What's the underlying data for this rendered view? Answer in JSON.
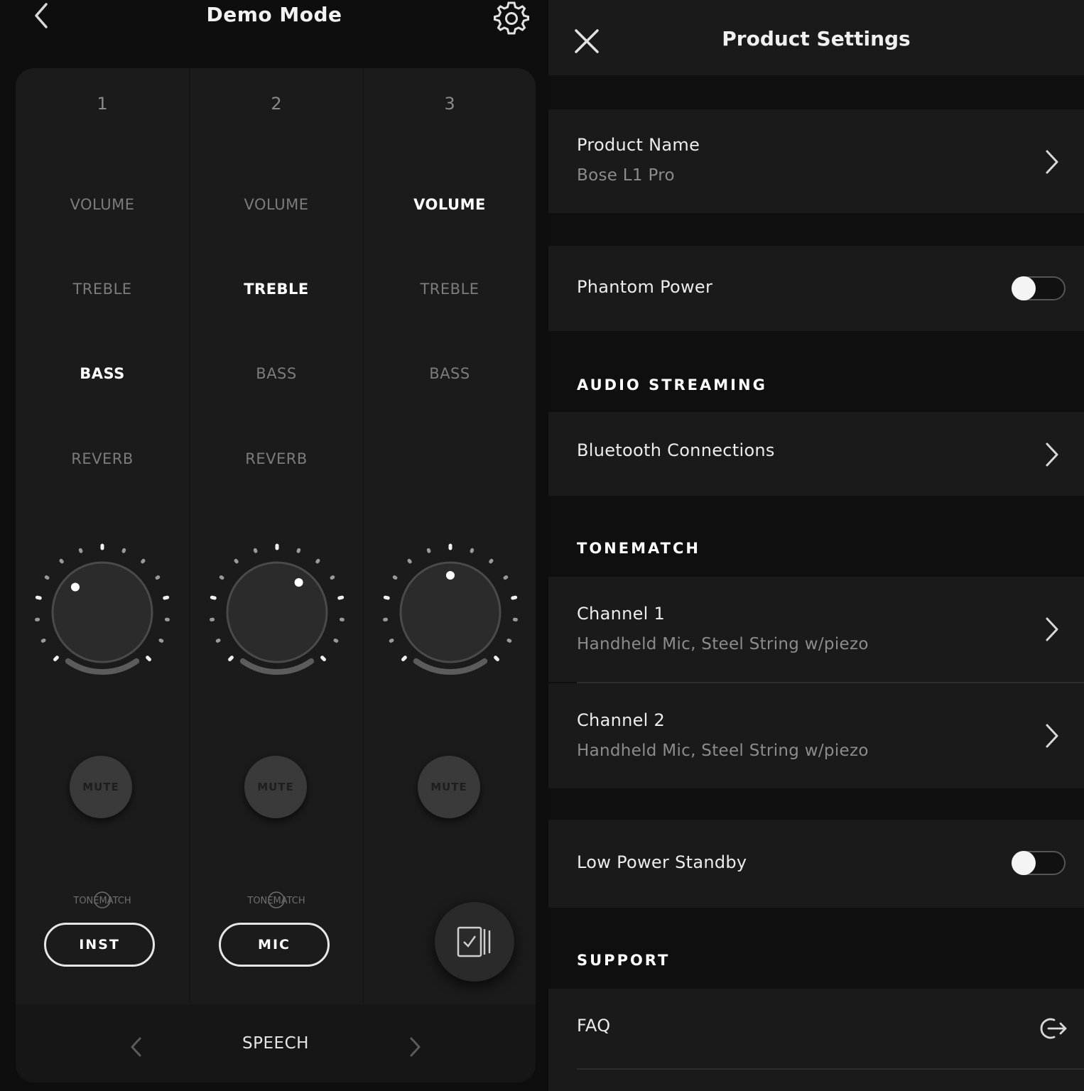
{
  "demo": {
    "title": "Demo Mode",
    "channels": [
      {
        "number": "1",
        "params": [
          "VOLUME",
          "TREBLE",
          "BASS",
          "REVERB"
        ],
        "active": "BASS",
        "mute_label": "MUTE",
        "tonematch_label": "INST"
      },
      {
        "number": "2",
        "params": [
          "VOLUME",
          "TREBLE",
          "BASS",
          "REVERB"
        ],
        "active": "TREBLE",
        "mute_label": "MUTE",
        "tonematch_label": "MIC"
      },
      {
        "number": "3",
        "params": [
          "VOLUME",
          "TREBLE",
          "BASS"
        ],
        "active": "VOLUME",
        "mute_label": "MUTE"
      }
    ],
    "tonematch_logo": "TONEMATCH",
    "scene": "SPEECH"
  },
  "settings": {
    "title": "Product Settings",
    "product_name_label": "Product Name",
    "product_name_value": "Bose L1 Pro",
    "phantom_power_label": "Phantom Power",
    "audio_streaming_header": "AUDIO STREAMING",
    "bluetooth_label": "Bluetooth Connections",
    "tonematch_header": "TONEMATCH",
    "channel1_label": "Channel 1",
    "channel1_value": "Handheld Mic, Steel String w/piezo",
    "channel2_label": "Channel 2",
    "channel2_value": "Handheld Mic, Steel String w/piezo",
    "low_power_label": "Low Power Standby",
    "support_header": "SUPPORT",
    "faq_label": "FAQ"
  },
  "icons": {
    "back": "chevron-left-icon",
    "settings": "gear-icon",
    "close": "close-icon",
    "chevron": "chevron-right-icon",
    "external": "external-link-icon",
    "presets": "preset-library-icon"
  },
  "colors": {
    "background": "#0e0e0e",
    "panel": "#1b1b1b",
    "active_text": "#ffffff",
    "inactive_text": "#7c7c7c",
    "secondary_text": "#8c8c8c"
  }
}
